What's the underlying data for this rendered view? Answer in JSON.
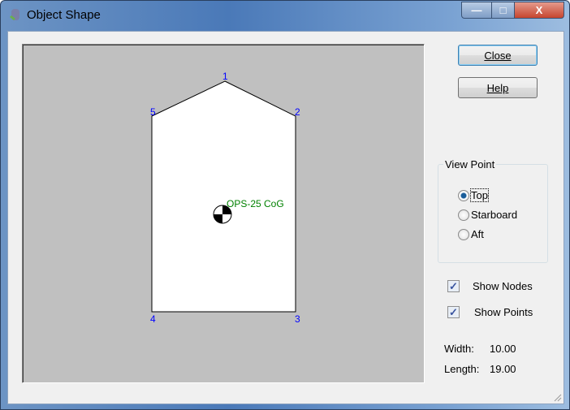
{
  "window": {
    "title": "Object Shape",
    "minimize": "—",
    "maximize": "□",
    "close": "X"
  },
  "buttons": {
    "close": "Close",
    "help": "Help"
  },
  "view_point": {
    "label": "View Point",
    "options": [
      {
        "label": "Top",
        "selected": true
      },
      {
        "label": "Starboard",
        "selected": false
      },
      {
        "label": "Aft",
        "selected": false
      }
    ]
  },
  "checks": {
    "show_nodes": {
      "label": "Show Nodes",
      "checked": true
    },
    "show_points": {
      "label": "Show Points",
      "checked": true
    }
  },
  "info": {
    "width_label": "Width:",
    "width_value": "10.00",
    "length_label": "Length:",
    "length_value": "19.00"
  },
  "shape": {
    "nodes": [
      "1",
      "2",
      "3",
      "4",
      "5"
    ],
    "cog_label": "OPS-25 CoG",
    "node_color": "#0000ff",
    "cog_color": "#008000"
  }
}
